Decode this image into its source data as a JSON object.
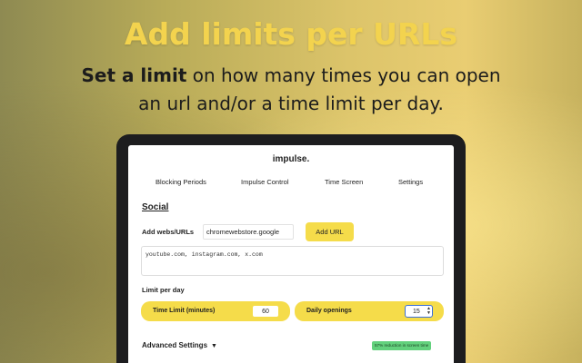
{
  "promo": {
    "headline": "Add limits per URLs",
    "subtitle_bold": "Set a limit",
    "subtitle_line1_rest": " on how many times you can open",
    "subtitle_line2": "an url and/or a time limit per day."
  },
  "app": {
    "title": "impulse.",
    "tabs": [
      "Blocking Periods",
      "Impulse Control",
      "Time Screen",
      "Settings"
    ]
  },
  "section": {
    "title": "Social",
    "add_label": "Add webs/URLs",
    "url_input_value": "chromewebstore.google",
    "add_button": "Add URL",
    "url_list": "youtube.com, instagram.com, x.com",
    "limit_label": "Limit per day",
    "time_limit_label": "Time Limit (minutes)",
    "time_limit_value": "60",
    "openings_label": "Daily openings",
    "openings_value": "15",
    "advanced_label": "Advanced Settings",
    "reduction_badge": "57% reduction in screen time"
  },
  "colors": {
    "accent_yellow": "#f5dc4a",
    "headline_yellow": "#f3d34e",
    "badge_green": "#63d17d",
    "focus_blue": "#3a6fd8"
  },
  "icons": {
    "advanced_toggle": "caret-down-icon",
    "stepper": "spinner-arrows-icon"
  }
}
